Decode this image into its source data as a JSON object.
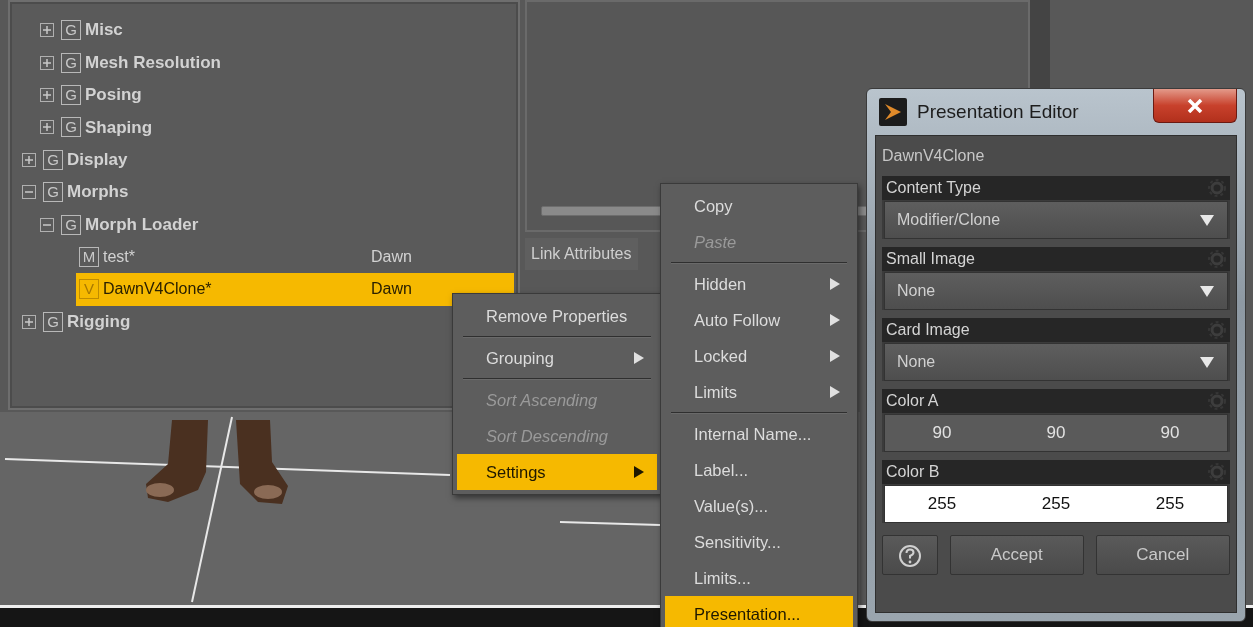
{
  "tree": {
    "partial_branch": [
      {
        "label": "Misc",
        "badge": "G",
        "expanded": false,
        "selected": false
      },
      {
        "label": "Mesh Resolution",
        "badge": "G",
        "expanded": false,
        "selected": false
      },
      {
        "label": "Posing",
        "badge": "G",
        "expanded": false,
        "selected": false
      },
      {
        "label": "Shaping",
        "badge": "G",
        "expanded": false,
        "selected": false
      }
    ],
    "items": [
      {
        "label": "Display",
        "badge": "G",
        "expanded": false,
        "selected": false
      },
      {
        "label": "Morphs",
        "badge": "G",
        "expanded": true,
        "selected": false,
        "children": [
          {
            "label": "Morph Loader",
            "badge": "G",
            "expanded": true,
            "selected": false,
            "children": [
              {
                "label": "test*",
                "badge": "M",
                "value": "Dawn",
                "selected": false
              },
              {
                "label": "DawnV4Clone*",
                "badge": "V",
                "value": "Dawn",
                "selected": true
              }
            ]
          }
        ]
      },
      {
        "label": "Rigging",
        "badge": "G",
        "expanded": false,
        "selected": false
      }
    ]
  },
  "right_panel": {
    "label": "Link Attributes"
  },
  "context_menu": {
    "items": [
      {
        "kind": "item",
        "label": "Remove Properties",
        "submenu": false,
        "disabled": false,
        "selected": false
      },
      {
        "kind": "separator"
      },
      {
        "kind": "item",
        "label": "Grouping",
        "submenu": true,
        "disabled": false,
        "selected": false
      },
      {
        "kind": "separator"
      },
      {
        "kind": "item",
        "label": "Sort Ascending",
        "submenu": false,
        "disabled": true,
        "selected": false
      },
      {
        "kind": "item",
        "label": "Sort Descending",
        "submenu": false,
        "disabled": true,
        "selected": false
      },
      {
        "kind": "item",
        "label": "Settings",
        "submenu": true,
        "disabled": false,
        "selected": true
      }
    ]
  },
  "submenu": {
    "items": [
      {
        "kind": "item",
        "label": "Copy",
        "submenu": false,
        "disabled": false,
        "selected": false
      },
      {
        "kind": "item",
        "label": "Paste",
        "submenu": false,
        "disabled": true,
        "selected": false
      },
      {
        "kind": "separator"
      },
      {
        "kind": "item",
        "label": "Hidden",
        "submenu": true,
        "disabled": false,
        "selected": false
      },
      {
        "kind": "item",
        "label": "Auto Follow",
        "submenu": true,
        "disabled": false,
        "selected": false
      },
      {
        "kind": "item",
        "label": "Locked",
        "submenu": true,
        "disabled": false,
        "selected": false
      },
      {
        "kind": "item",
        "label": "Limits",
        "submenu": true,
        "disabled": false,
        "selected": false
      },
      {
        "kind": "separator"
      },
      {
        "kind": "item",
        "label": "Internal Name...",
        "submenu": false,
        "disabled": false,
        "selected": false
      },
      {
        "kind": "item",
        "label": "Label...",
        "submenu": false,
        "disabled": false,
        "selected": false
      },
      {
        "kind": "item",
        "label": "Value(s)...",
        "submenu": false,
        "disabled": false,
        "selected": false
      },
      {
        "kind": "item",
        "label": "Sensitivity...",
        "submenu": false,
        "disabled": false,
        "selected": false
      },
      {
        "kind": "item",
        "label": "Limits...",
        "submenu": false,
        "disabled": false,
        "selected": false
      },
      {
        "kind": "item",
        "label": "Presentation...",
        "submenu": false,
        "disabled": false,
        "selected": true
      }
    ]
  },
  "dialog": {
    "title": "Presentation Editor",
    "node_name": "DawnV4Clone",
    "sections": [
      {
        "kind": "select",
        "label": "Content Type",
        "value": "Modifier/Clone"
      },
      {
        "kind": "select",
        "label": "Small Image",
        "value": "None"
      },
      {
        "kind": "select",
        "label": "Card Image",
        "value": "None"
      },
      {
        "kind": "color",
        "label": "Color A",
        "values": [
          "90",
          "90",
          "90"
        ]
      },
      {
        "kind": "color",
        "label": "Color B",
        "values": [
          "255",
          "255",
          "255"
        ]
      }
    ],
    "help_button": true,
    "buttons": [
      "Accept",
      "Cancel"
    ]
  }
}
